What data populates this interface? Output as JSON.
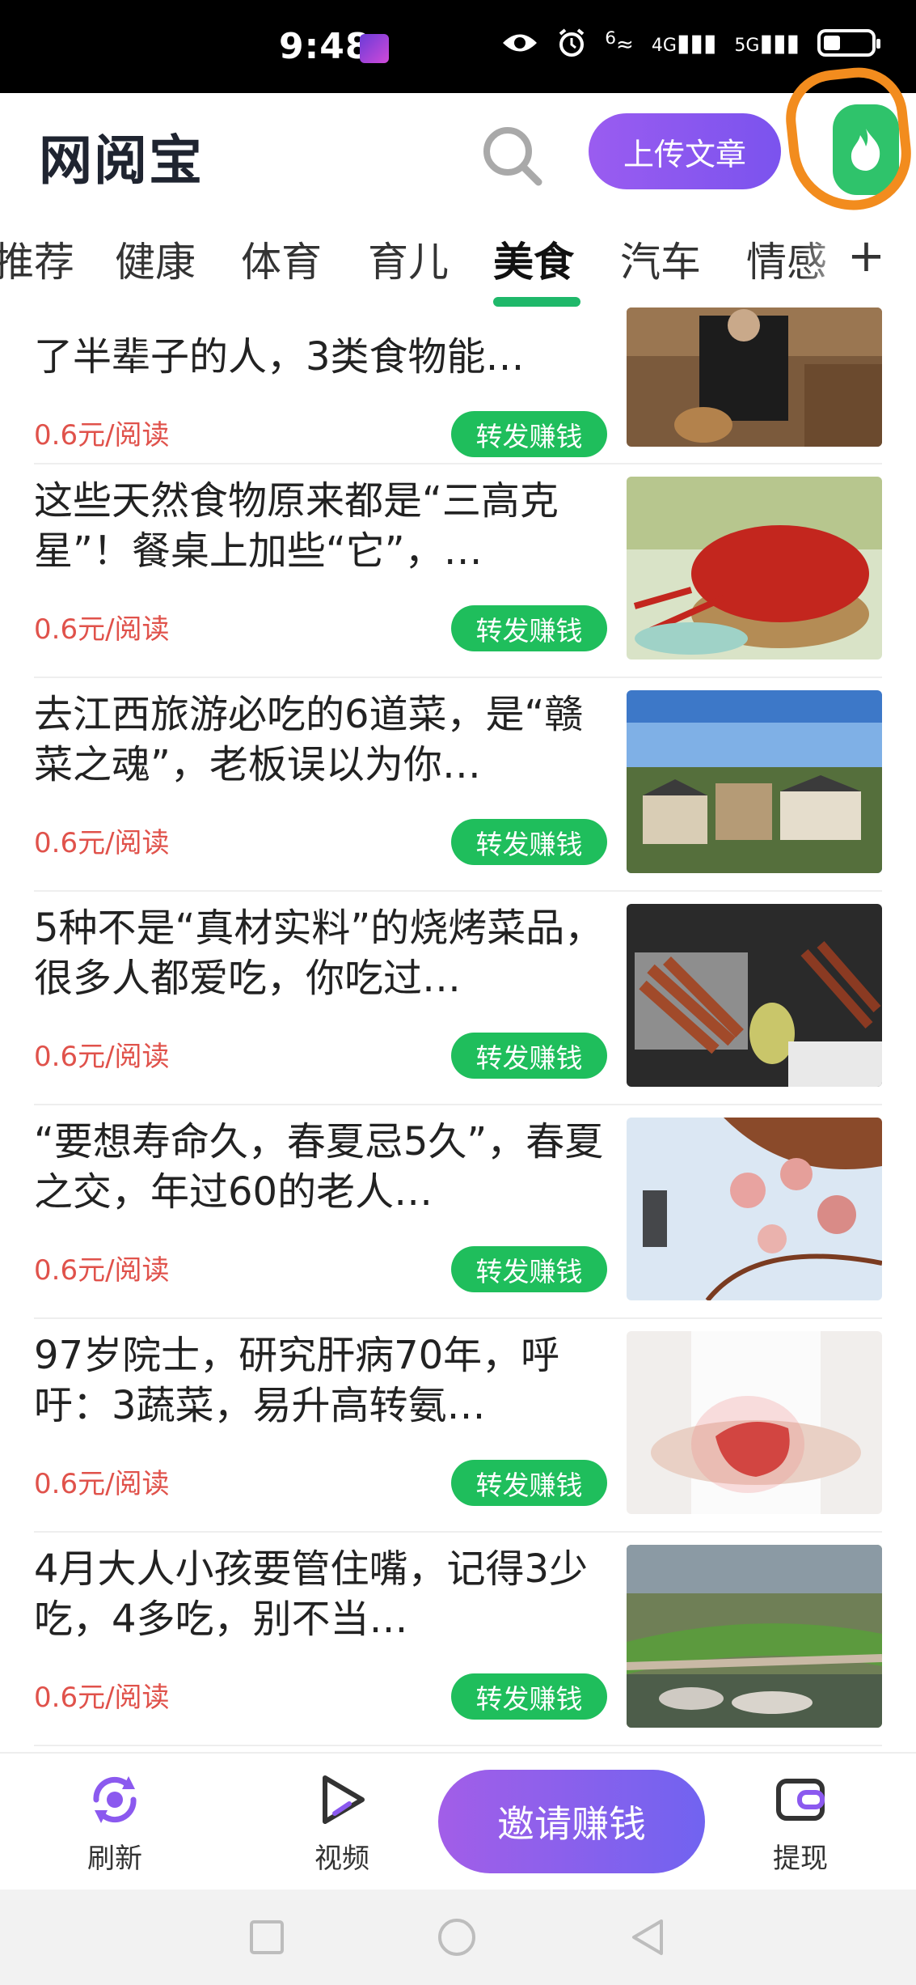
{
  "status": {
    "time": "9:48",
    "signal_labels": [
      "6",
      "4G",
      "5G"
    ]
  },
  "header": {
    "logo": "网阅宝",
    "upload_label": "上传文章"
  },
  "tabs": [
    {
      "label": "推荐"
    },
    {
      "label": "健康"
    },
    {
      "label": "体育"
    },
    {
      "label": "育儿"
    },
    {
      "label": "美食"
    },
    {
      "label": "汽车"
    },
    {
      "label": "情感"
    }
  ],
  "active_tab": "美食",
  "feed": {
    "items": [
      {
        "title": "了半辈子的人，3类食物能…",
        "price": "0.6元/阅读",
        "share": "转发赚钱"
      },
      {
        "title": "这些天然食物原来都是“三高克星”！餐桌上加些“它”，…",
        "price": "0.6元/阅读",
        "share": "转发赚钱"
      },
      {
        "title": "去江西旅游必吃的6道菜，是“赣菜之魂”，老板误以为你…",
        "price": "0.6元/阅读",
        "share": "转发赚钱"
      },
      {
        "title": "5种不是“真材实料”的烧烤菜品，很多人都爱吃，你吃过…",
        "price": "0.6元/阅读",
        "share": "转发赚钱"
      },
      {
        "title": "“要想寿命久，春夏忌5久”，春夏之交，年过60的老人…",
        "price": "0.6元/阅读",
        "share": "转发赚钱"
      },
      {
        "title": "97岁院士，研究肝病70年，呼吁：3蔬菜，易升高转氨…",
        "price": "0.6元/阅读",
        "share": "转发赚钱"
      },
      {
        "title": "4月大人小孩要管住嘴，记得3少吃，4多吃，别不当…",
        "price": "0.6元/阅读",
        "share": "转发赚钱"
      }
    ]
  },
  "bottom_nav": {
    "refresh": "刷新",
    "video": "视频",
    "invite": "邀请赚钱",
    "withdraw": "提现"
  },
  "colors": {
    "accent_purple": "#8b59ef",
    "green": "#1fbe5c",
    "price_red": "#e0524b"
  }
}
